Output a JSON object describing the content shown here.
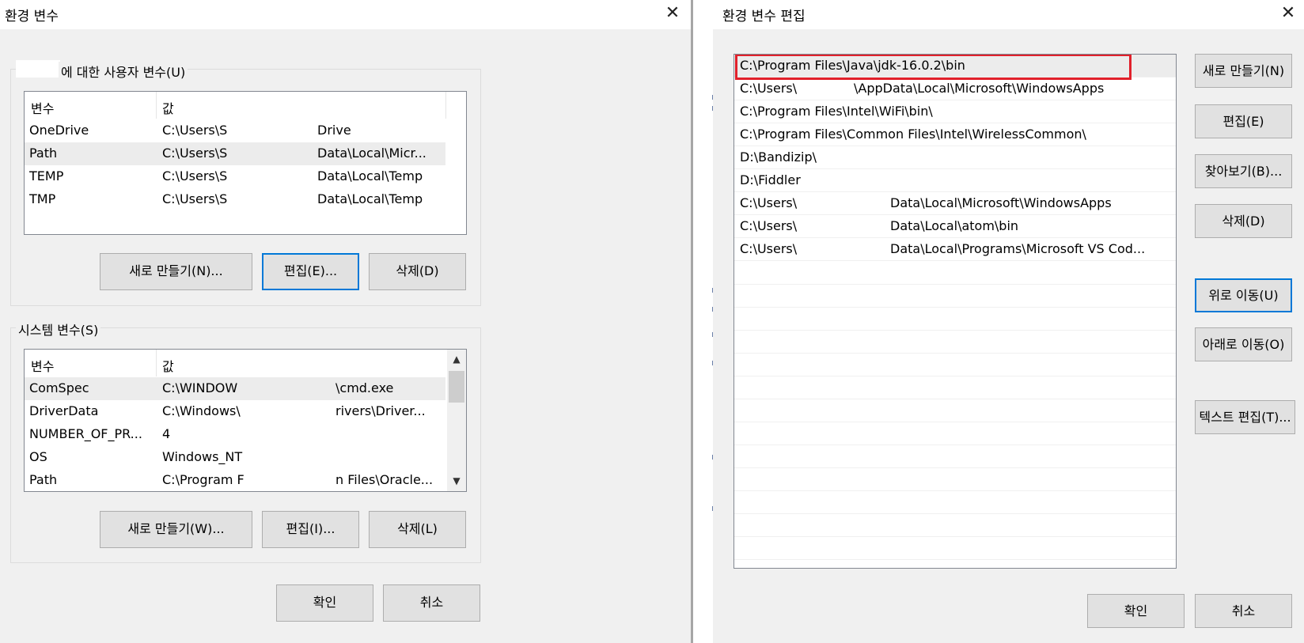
{
  "left_dialog": {
    "title": "환경 변수",
    "close_glyph": "✕",
    "user_vars": {
      "group_title": "에 대한 사용자 변수(U)",
      "columns": [
        "변수",
        "값"
      ],
      "rows": [
        {
          "name": "OneDrive",
          "value_start": "C:\\Users\\S",
          "value_end": "Drive"
        },
        {
          "name": "Path",
          "value_start": "C:\\Users\\S",
          "value_end": "Data\\Local\\Micr..."
        },
        {
          "name": "TEMP",
          "value_start": "C:\\Users\\S",
          "value_end": "Data\\Local\\Temp"
        },
        {
          "name": "TMP",
          "value_start": "C:\\Users\\S",
          "value_end": "Data\\Local\\Temp"
        }
      ],
      "buttons": {
        "new": "새로 만들기(N)...",
        "edit": "편집(E)...",
        "delete": "삭제(D)"
      }
    },
    "system_vars": {
      "group_title": "시스템 변수(S)",
      "columns": [
        "변수",
        "값"
      ],
      "rows": [
        {
          "name": "ComSpec",
          "value_start": "C:\\WINDOW",
          "value_end": "\\cmd.exe"
        },
        {
          "name": "DriverData",
          "value_start": "C:\\Windows\\",
          "value_end": "rivers\\Driver..."
        },
        {
          "name": "NUMBER_OF_PR...",
          "value_start": "4",
          "value_end": ""
        },
        {
          "name": "OS",
          "value_start": "Windows_NT",
          "value_end": ""
        },
        {
          "name": "Path",
          "value_start": "C:\\Program F",
          "value_end": "n Files\\Oracle..."
        }
      ],
      "buttons": {
        "new": "새로 만들기(W)...",
        "edit": "편집(I)...",
        "delete": "삭제(L)"
      },
      "scroll_up_glyph": "▲",
      "scroll_down_glyph": "▼"
    },
    "ok": "확인",
    "cancel": "취소"
  },
  "right_dialog": {
    "title": "환경 변수 편집",
    "close_glyph": "✕",
    "paths": [
      "C:\\Program Files\\Java\\jdk-16.0.2\\bin",
      "C:\\Users\\",
      "C:\\Program Files\\Intel\\WiFi\\bin\\",
      "C:\\Program Files\\Common Files\\Intel\\WirelessCommon\\",
      "D:\\Bandizip\\",
      "D:\\Fiddler",
      "C:\\Users\\",
      "C:\\Users\\",
      "C:\\Users\\"
    ],
    "path_tails": [
      "",
      "\\AppData\\Local\\Microsoft\\WindowsApps",
      "",
      "",
      "",
      "",
      "Data\\Local\\Microsoft\\WindowsApps",
      "Data\\Local\\atom\\bin",
      "Data\\Local\\Programs\\Microsoft VS Cod..."
    ],
    "buttons": {
      "new": "새로 만들기(N)",
      "edit": "편집(E)",
      "browse": "찾아보기(B)...",
      "delete": "삭제(D)",
      "move_up": "위로 이동(U)",
      "move_down": "아래로 이동(O)",
      "edit_text": "텍스트 편집(T)..."
    },
    "ok": "확인",
    "cancel": "취소"
  },
  "colors": {
    "dialog_bg": "#f0f0f0",
    "highlight_border": "#e1202b",
    "focus_border": "#0078d7",
    "selected_row": "#ececec"
  }
}
